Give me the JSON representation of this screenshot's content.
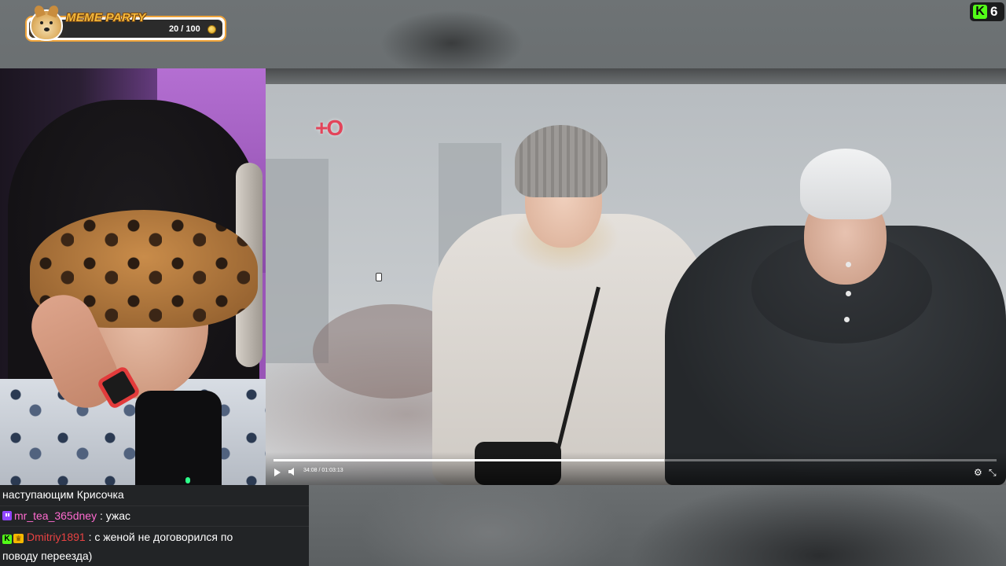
{
  "meme_widget": {
    "title": "MEME PARTY",
    "count": "20 / 100",
    "progress": 0.2,
    "icon": "doge-icon",
    "coin_icon": "coin-icon",
    "title_color": "#f6b93b"
  },
  "viewer_badge": {
    "platform_icon": "kick-logo-icon",
    "logo_letter": "K",
    "count": "6",
    "accent": "#53fc18"
  },
  "video": {
    "channel_logo": "+O",
    "time": "34:08 / 01:03:13",
    "progress": 0.54,
    "controls": [
      "play-icon",
      "volume-icon",
      "settings-icon",
      "fullscreen-icon"
    ]
  },
  "chat": {
    "messages": [
      {
        "text": "наступающим Крисочка"
      },
      {
        "platform": "twitch",
        "user": "mr_tea_365dney",
        "separator": " : ",
        "text": "ужас",
        "user_color": "#ff6bd0"
      },
      {
        "platform": "kick",
        "badge": "crown",
        "user": "Dmitriy1891",
        "separator": " : ",
        "text": "с женой не договорился по",
        "user_color": "#e84242"
      },
      {
        "text": "поводу переезда)"
      }
    ]
  }
}
